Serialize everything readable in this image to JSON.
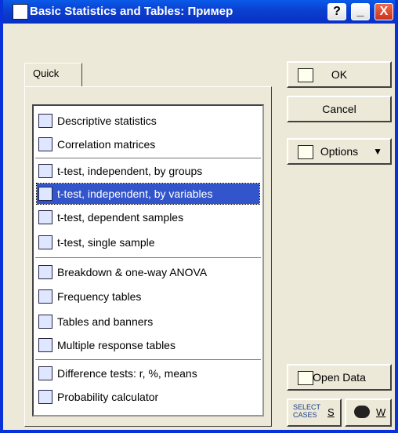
{
  "window": {
    "title": "Basic Statistics and Tables: Пример"
  },
  "titlebar_buttons": {
    "help": "?",
    "minimize": "_",
    "close": "X"
  },
  "tabs": [
    {
      "label": "Quick"
    }
  ],
  "list": {
    "items": [
      {
        "label": "Descriptive statistics",
        "icon": "descriptive-stats-icon"
      },
      {
        "label": "Correlation matrices",
        "icon": "correlation-icon"
      },
      {
        "label": "t-test, independent, by groups",
        "icon": "ttest-groups-icon"
      },
      {
        "label": "t-test, independent, by variables",
        "icon": "ttest-vars-icon",
        "selected": true
      },
      {
        "label": "t-test, dependent samples",
        "icon": "ttest-dependent-icon"
      },
      {
        "label": "t-test, single sample",
        "icon": "ttest-single-icon"
      },
      {
        "label": "Breakdown & one-way ANOVA",
        "icon": "breakdown-icon"
      },
      {
        "label": "Frequency tables",
        "icon": "frequency-table-icon"
      },
      {
        "label": "Tables and banners",
        "icon": "tables-banners-icon"
      },
      {
        "label": "Multiple response tables",
        "icon": "multiple-response-icon"
      },
      {
        "label": "Difference tests: r, %, means",
        "icon": "difference-tests-icon"
      },
      {
        "label": "Probability calculator",
        "icon": "probability-calculator-icon"
      }
    ]
  },
  "buttons": {
    "ok": "OK",
    "cancel": "Cancel",
    "options": "Options",
    "open_data": "Open Data",
    "select_cases": "SELECT CASES",
    "select_cases_key": "S",
    "weight_key": "W"
  }
}
